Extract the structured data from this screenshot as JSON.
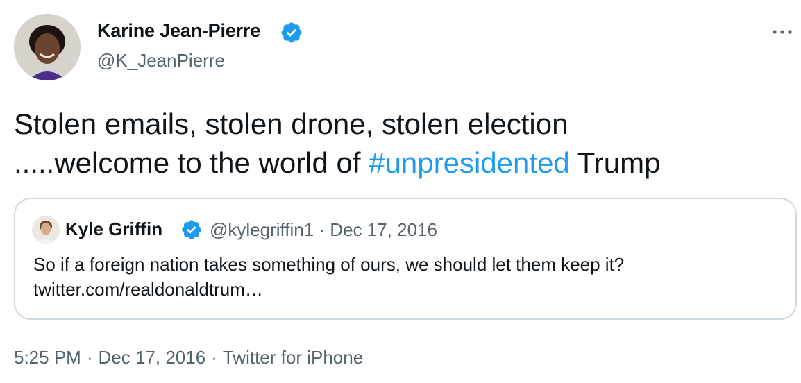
{
  "author": {
    "name": "Karine Jean-Pierre",
    "handle": "@K_JeanPierre"
  },
  "tweet": {
    "line1": "Stolen emails, stolen drone, stolen election",
    "line2_prefix": ".....welcome to the world of ",
    "hashtag": "#unpresidented",
    "line2_suffix": " Trump"
  },
  "quoted_tweet": {
    "author_name": "Kyle Griffin",
    "meta": "@kylegriffin1 · Dec 17, 2016",
    "text_line1": "So if a foreign nation takes something of ours, we should let them keep it?",
    "text_line2": "twitter.com/realdonaldtrum…"
  },
  "footer": {
    "time": "5:25 PM",
    "separator": "·",
    "date": "Dec 17, 2016",
    "source": "Twitter for iPhone"
  },
  "icons": {
    "verified": "verified-badge-icon",
    "more": "more-options-icon"
  },
  "colors": {
    "accent": "#1d9bf0",
    "text": "#0f1419",
    "secondary": "#536471",
    "border": "#cfd9de"
  }
}
